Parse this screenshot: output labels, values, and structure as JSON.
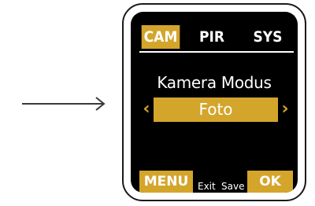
{
  "pointer": {
    "icon": "right-arrow-icon"
  },
  "tabs": [
    {
      "label": "CAM",
      "active": true
    },
    {
      "label": "PIR",
      "active": false
    },
    {
      "label": "SYS",
      "active": false
    }
  ],
  "setting": {
    "title": "Kamera Modus",
    "value": "Foto",
    "prev_icon": "chevron-left-icon",
    "next_icon": "chevron-right-icon"
  },
  "footer": {
    "menu_label": "MENU",
    "exit_label": "Exit",
    "save_label": "Save",
    "ok_label": "OK"
  },
  "colors": {
    "accent": "#d4a52b",
    "screen_bg": "#000000",
    "text": "#ffffff",
    "frame": "#1a1a1a"
  }
}
